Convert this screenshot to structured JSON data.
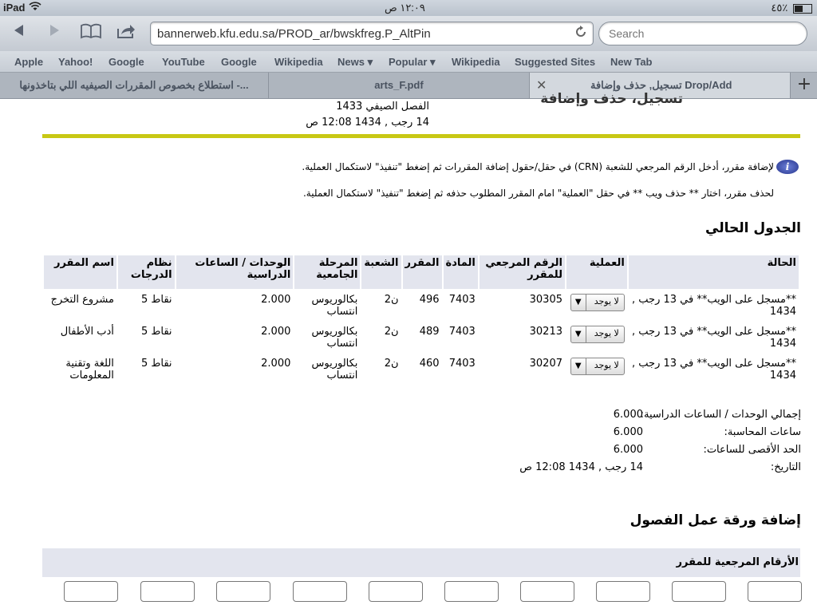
{
  "status_bar": {
    "device": "iPad",
    "time": "١٢:٠٩ ص",
    "battery": "٤٥٪"
  },
  "browser": {
    "url": "bannerweb.kfu.edu.sa/PROD_ar/bwskfreg.P_AltPin",
    "search_placeholder": "Search",
    "bookmarks": [
      "Apple",
      "Yahoo!",
      "Google",
      "YouTube",
      "Google",
      "Wikipedia",
      "News ▾",
      "Popular ▾",
      "Wikipedia",
      "Suggested Sites",
      "New Tab"
    ],
    "tabs": [
      {
        "label": "استطلاع بخصوص المقررات الصيفيه اللي بتاخذونها -..."
      },
      {
        "label": "arts_F.pdf"
      },
      {
        "label": "تسجيل, حذف وإضافة Drop/Add"
      }
    ]
  },
  "page": {
    "cut_heading": "تسجيل، حذف وإضافة",
    "term": "الفصل الصيفي 1433",
    "datetime": "14 رجب , 1434 12:08 ص",
    "instruction_add": "لإضافة مقرر، أدخل الرقم المرجعي للشعبة (CRN) في حقل/حقول إضافة المقررات ثم إضغط \"تنفيذ\" لاستكمال العملية.",
    "instruction_drop": "لحذف مقرر، اختار ** حذف ويب ** في حقل \"العملية\" امام المقرر المطلوب حذفه ثم إضغط \"تنفيذ\" لاستكمال العملية.",
    "schedule_title": "الجدول الحالي",
    "columns": [
      "الحالة",
      "العملية",
      "الرقم المرجعي للمقرر",
      "المادة",
      "المقرر",
      "الشعبة",
      "المرحلة الجامعية",
      "الوحدات / الساعات الدراسية",
      "نظام الدرجات",
      "اسم المقرر"
    ],
    "rows": [
      {
        "status": "**مسجل على الويب** في 13 رجب , 1434",
        "action": "لا يوجد",
        "crn": "30305",
        "subject": "7403",
        "course": "496",
        "section": "ن2",
        "level": "بكالوريوس انتساب",
        "credits": "2.000",
        "grade_mode": "نقاط 5",
        "title": "مشروع التخرج"
      },
      {
        "status": "**مسجل على الويب** في 13 رجب , 1434",
        "action": "لا يوجد",
        "crn": "30213",
        "subject": "7403",
        "course": "489",
        "section": "ن2",
        "level": "بكالوريوس انتساب",
        "credits": "2.000",
        "grade_mode": "نقاط 5",
        "title": "أدب الأطفال"
      },
      {
        "status": "**مسجل على الويب** في 13 رجب , 1434",
        "action": "لا يوجد",
        "crn": "30207",
        "subject": "7403",
        "course": "460",
        "section": "ن2",
        "level": "بكالوريوس انتساب",
        "credits": "2.000",
        "grade_mode": "نقاط 5",
        "title": "اللغة وتقنية المعلومات"
      }
    ],
    "totals": [
      {
        "label": "إجمالي الوحدات / الساعات الدراسية:",
        "value": "6.000"
      },
      {
        "label": "ساعات المحاسبة:",
        "value": "6.000"
      },
      {
        "label": "الحد الأقصى للساعات:",
        "value": "6.000"
      },
      {
        "label": "التاريخ:",
        "value": "14 رجب , 1434 12:08 ص"
      }
    ],
    "add_title": "إضافة ورقة عمل الفصول",
    "crn_header": "الأرقام المرجعية للمقرر",
    "crn_inputs": [
      "",
      "",
      "",
      "",
      "",
      "",
      "",
      "",
      "",
      ""
    ]
  }
}
